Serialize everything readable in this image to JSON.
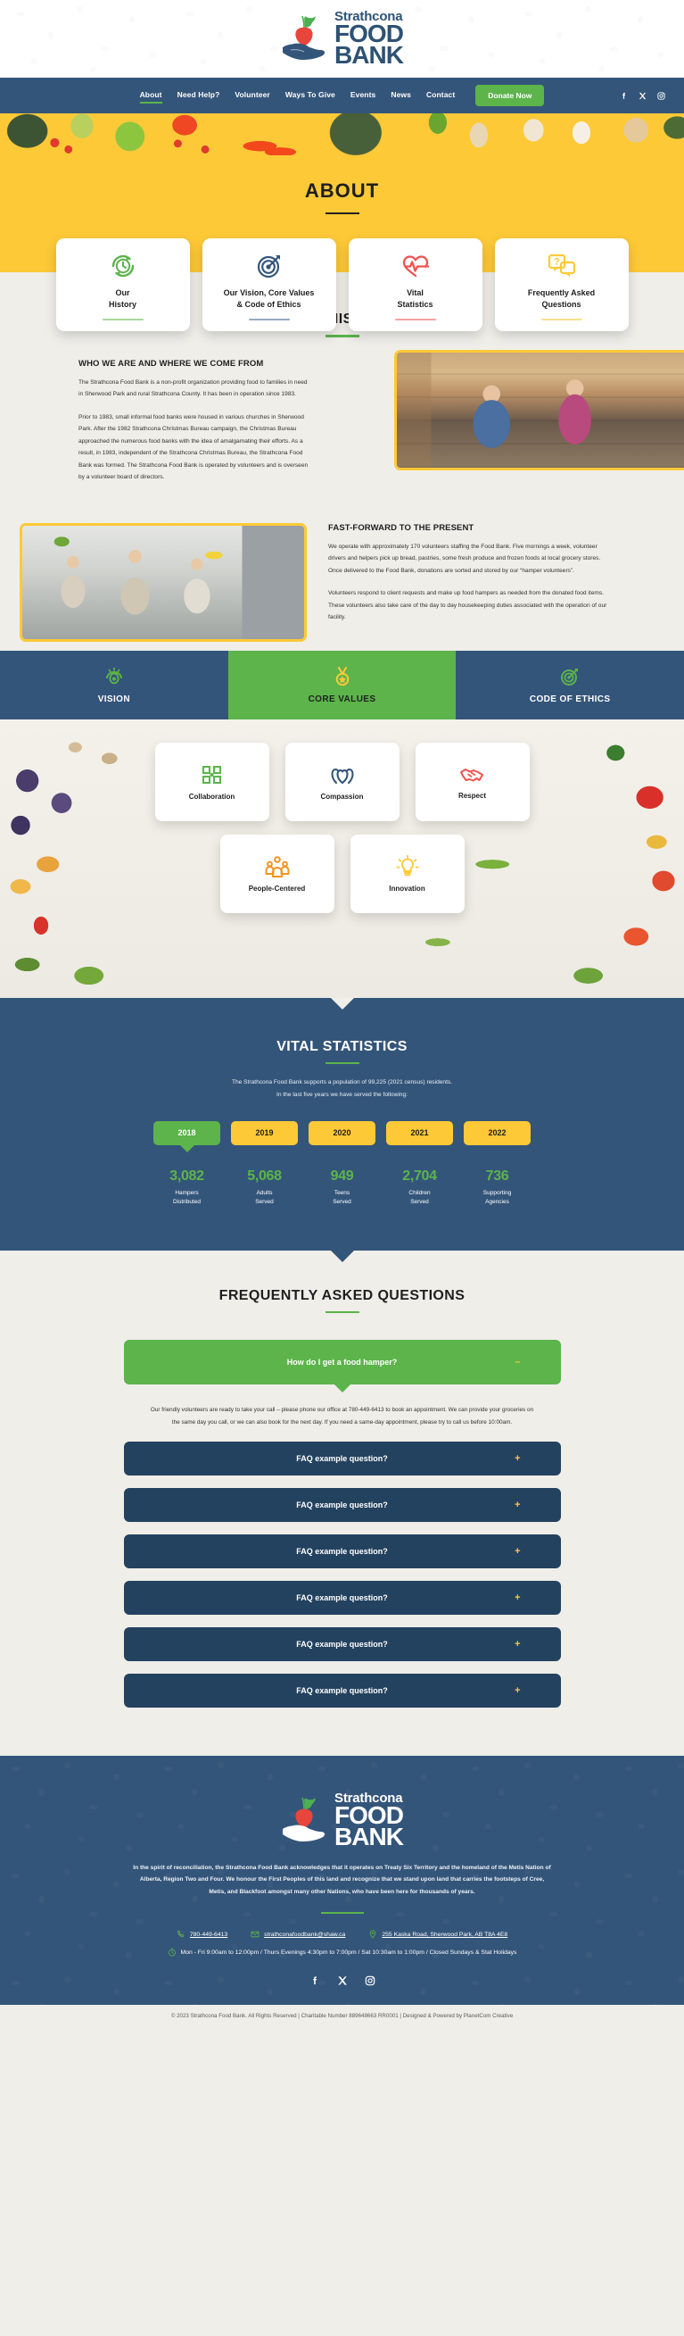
{
  "brand": {
    "line1": "Strathcona",
    "line2": "FOOD",
    "line3": "BANK"
  },
  "nav": {
    "items": [
      {
        "label": "About",
        "active": true
      },
      {
        "label": "Need Help?",
        "active": false
      },
      {
        "label": "Volunteer",
        "active": false
      },
      {
        "label": "Ways To Give",
        "active": false
      },
      {
        "label": "Events",
        "active": false
      },
      {
        "label": "News",
        "active": false
      },
      {
        "label": "Contact",
        "active": false
      }
    ],
    "donate_label": "Donate Now",
    "social": [
      "facebook-icon",
      "x-twitter-icon",
      "instagram-icon"
    ]
  },
  "hero": {
    "title": "ABOUT"
  },
  "topcards": [
    {
      "title": "Our\nHistory",
      "icon": "history-clock-icon",
      "color": "#5cb44b"
    },
    {
      "title": "Our Vision, Core Values\n& Code of Ethics",
      "icon": "target-arrow-icon",
      "color": "#34557a"
    },
    {
      "title": "Vital\nStatistics",
      "icon": "heartbeat-icon",
      "color": "#ef5350"
    },
    {
      "title": "Frequently Asked\nQuestions",
      "icon": "question-chat-icon",
      "color": "#fdc937"
    }
  ],
  "history": {
    "heading": "OUR HISTORY",
    "subheading": "WHO WE ARE AND WHERE WE COME FROM",
    "p1": "The Strathcona Food Bank is a non-profit organization providing food to families in need in Sherwood Park and rural Strathcona County.  It has been in operation since 1983.",
    "p2": "Prior to 1983, small informal food banks were housed in various churches in Sherwood Park.  After the 1982 Strathcona Christmas Bureau campaign, the Christmas Bureau approached the numerous food banks with the idea of amalgamating their efforts.  As a result, in 1983, independent of the Strathcona Christmas Bureau, the Strathcona Food Bank was formed.  The Strathcona Food Bank is operated by volunteers and is overseen by a volunteer board of directors.",
    "photo_alt": "volunteers-in-food-bank-pantry"
  },
  "present": {
    "heading": "FAST-FORWARD TO THE PRESENT",
    "p1": "We operate with approximately 170 volunteers staffing the Food Bank. Five mornings a week, volunteer drivers and helpers pick up bread, pastries, some fresh produce and frozen foods at local grocery stores. Once delivered to the Food Bank, donations are sorted and stored by our “hamper volunteers”.",
    "p2": "Volunteers respond to client requests and make up food hampers as needed from the donated food items.  These volunteers also take care of the day to day housekeeping duties associated with the operation of our facility.",
    "photo_alt": "three-volunteers-holding-food"
  },
  "vcv": {
    "tabs": [
      {
        "label": "VISION",
        "icon": "eye-vision-icon",
        "active": false
      },
      {
        "label": "CORE VALUES",
        "icon": "medal-icon",
        "active": true
      },
      {
        "label": "CODE OF ETHICS",
        "icon": "target-arrow-icon",
        "active": false
      }
    ]
  },
  "core_values": {
    "row1": [
      {
        "label": "Collaboration",
        "icon": "collaboration-icon",
        "color": "#5cb44b"
      },
      {
        "label": "Compassion",
        "icon": "compassion-hands-icon",
        "color": "#34557a"
      },
      {
        "label": "Respect",
        "icon": "handshake-icon",
        "color": "#ef5350"
      }
    ],
    "row2": [
      {
        "label": "People-Centered",
        "icon": "people-group-icon",
        "color": "#f2941f"
      },
      {
        "label": "Innovation",
        "icon": "lightbulb-icon",
        "color": "#fdc937"
      }
    ]
  },
  "vital": {
    "heading": "VITAL STATISTICS",
    "sub1": "The Strathcona Food Bank supports a population of 99,225 (2021 census) residents.",
    "sub2": "In the last five years we have served the following:",
    "years": [
      {
        "label": "2018",
        "active": true
      },
      {
        "label": "2019",
        "active": false
      },
      {
        "label": "2020",
        "active": false
      },
      {
        "label": "2021",
        "active": false
      },
      {
        "label": "2022",
        "active": false
      }
    ],
    "stats": [
      {
        "value": "3,082",
        "label": "Hampers\nDistributed"
      },
      {
        "value": "5,068",
        "label": "Adults\nServed"
      },
      {
        "value": "949",
        "label": "Teens\nServed"
      },
      {
        "value": "2,704",
        "label": "Children\nServed"
      },
      {
        "value": "736",
        "label": "Supporting\nAgencies"
      }
    ]
  },
  "faq": {
    "heading": "FREQUENTLY ASKED QUESTIONS",
    "open_question": "How do I get a food hamper?",
    "open_sign": "–",
    "open_answer": "Our friendly volunteers are ready to take your call –  please phone our office at 780-449-6413 to book an appointment.  We can provide your groceries on the same day you call, or we can also book for the next day. If you need a same-day appointment, please try to call us before 10:00am.",
    "closed_sign": "+",
    "items": [
      {
        "question": "FAQ example question?"
      },
      {
        "question": "FAQ example question?"
      },
      {
        "question": "FAQ example question?"
      },
      {
        "question": "FAQ example question?"
      },
      {
        "question": "FAQ example question?"
      },
      {
        "question": "FAQ example question?"
      }
    ]
  },
  "footer": {
    "land_acknowledgement": "In the spirit of reconciliation, the Strathcona Food Bank acknowledges that it operates on Treaty Six Territory and the homeland of the Metis Nation of Alberta, Region Two and Four. We honour the First Peoples of this land and recognize that we stand upon land that carries the footsteps of Cree, Metis, and Blackfoot amongst many other Nations, who have been here for thousands of years.",
    "phone": "780-449-6413",
    "email": "strathconafoodbank@shaw.ca",
    "address": "255 Kaska Road, Sherwood Park, AB T8A 4E8",
    "hours": "Mon - Fri 9:00am to 12:00pm / Thurs Evenings 4:30pm to 7:00pm / Sat 10:30am to 1:00pm / Closed Sundays & Stat Holidays",
    "social": [
      "facebook-icon",
      "x-twitter-icon",
      "instagram-icon"
    ],
    "copyright": "© 2023 Strathcona Food Bank. All Rights Reserved  |  Charitable Number 889648663 RR0001  |  Designed & Powered by PlanetCom Creative"
  },
  "colors": {
    "navy": "#34557a",
    "navy_dark": "#23425f",
    "green": "#5cb44b",
    "yellow": "#fdc937",
    "red": "#ef5350",
    "orange": "#f2941f",
    "cream": "#efeee9"
  }
}
